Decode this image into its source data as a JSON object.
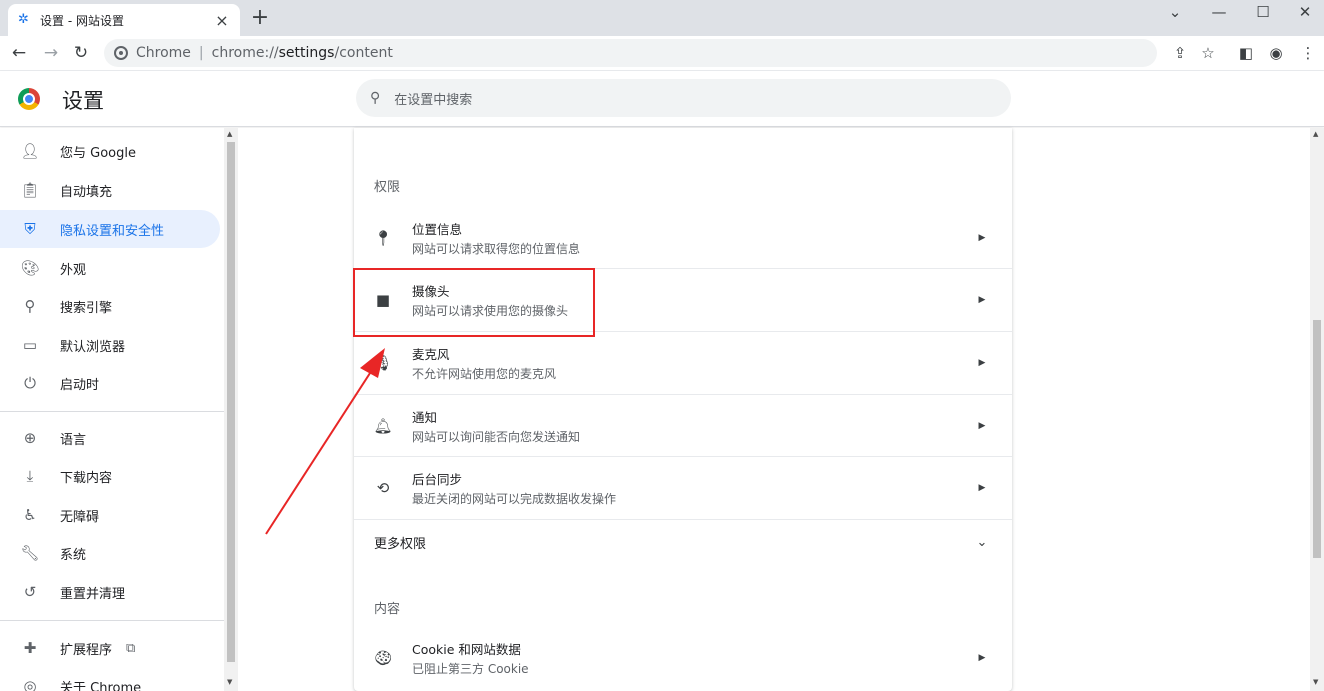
{
  "tab": {
    "title": "设置 - 网站设置",
    "close": "×",
    "new_tab": "+"
  },
  "window": {
    "minimize": "—",
    "maximize": "☐",
    "close": "✕",
    "tab_search": "⌄"
  },
  "toolbar": {
    "site_label": "Chrome",
    "separator": "|",
    "url_prefix": "chrome://",
    "url_host": "settings",
    "url_path": "/content"
  },
  "header": {
    "title": "设置",
    "search_placeholder": "在设置中搜索"
  },
  "sidebar": {
    "items": [
      {
        "label": "您与 Google",
        "icon": "person-icon"
      },
      {
        "label": "自动填充",
        "icon": "clipboard-icon"
      },
      {
        "label": "隐私设置和安全性",
        "icon": "shield-icon"
      },
      {
        "label": "外观",
        "icon": "palette-icon"
      },
      {
        "label": "搜索引擎",
        "icon": "search-icon"
      },
      {
        "label": "默认浏览器",
        "icon": "browser-icon"
      },
      {
        "label": "启动时",
        "icon": "power-icon"
      },
      {
        "label": "语言",
        "icon": "globe-icon"
      },
      {
        "label": "下载内容",
        "icon": "download-icon"
      },
      {
        "label": "无障碍",
        "icon": "accessibility-icon"
      },
      {
        "label": "系统",
        "icon": "wrench-icon"
      },
      {
        "label": "重置并清理",
        "icon": "restore-icon"
      },
      {
        "label": "扩展程序",
        "icon": "puzzle-icon"
      },
      {
        "label": "关于 Chrome",
        "icon": "chrome-icon"
      }
    ]
  },
  "permissions": {
    "title": "权限",
    "items": [
      {
        "label": "位置信息",
        "sub": "网站可以请求取得您的位置信息",
        "icon": "location-icon"
      },
      {
        "label": "摄像头",
        "sub": "网站可以请求使用您的摄像头",
        "icon": "camera-icon"
      },
      {
        "label": "麦克风",
        "sub": "不允许网站使用您的麦克风",
        "icon": "mic-icon"
      },
      {
        "label": "通知",
        "sub": "网站可以询问能否向您发送通知",
        "icon": "bell-icon"
      },
      {
        "label": "后台同步",
        "sub": "最近关闭的网站可以完成数据收发操作",
        "icon": "sync-icon"
      }
    ],
    "more": "更多权限"
  },
  "content": {
    "title": "内容",
    "items": [
      {
        "label": "Cookie 和网站数据",
        "sub": "已阻止第三方 Cookie",
        "icon": "cookie-icon"
      }
    ]
  },
  "colors": {
    "accent": "#1a73e8",
    "annotation": "#e82626"
  }
}
